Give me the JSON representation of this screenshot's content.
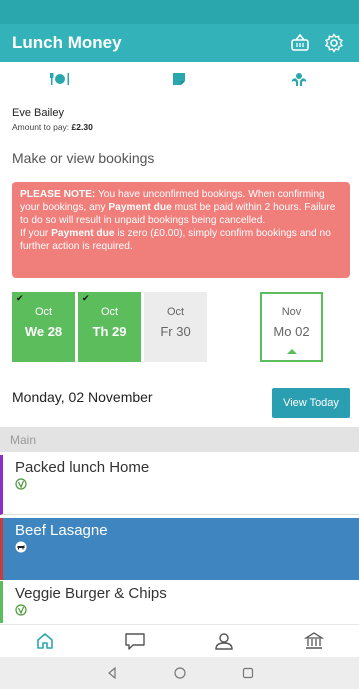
{
  "app": {
    "title": "Lunch Money"
  },
  "colors": {
    "primary": "#33b3b9",
    "confirmed": "#5cbd5c",
    "notice": "#f07f7b",
    "selected_meal": "#3f86c1",
    "button": "#2a9fb2"
  },
  "header_icons": [
    "basket-icon",
    "gear-icon"
  ],
  "tabs": [
    "meal-icon",
    "note-icon",
    "allergy-icon"
  ],
  "student": {
    "name": "Eve Bailey",
    "amount_label": "Amount to pay:",
    "amount": "£2.30"
  },
  "section_title": "Make or view bookings",
  "notice": {
    "label": "PLEASE NOTE:",
    "text1": " You have unconfirmed bookings. When confirming your bookings, any ",
    "bold1": "Payment due",
    "text2": " must be paid within 2 hours. Failure to do so will result in unpaid bookings being cancelled.",
    "text3": "If your ",
    "bold2": "Payment due",
    "text4": " is zero (£0.00), simply confirm bookings and no further action is required."
  },
  "days": [
    {
      "month": "Oct",
      "day": "We 28",
      "status": "confirmed",
      "check": "✔"
    },
    {
      "month": "Oct",
      "day": "Th 29",
      "status": "confirmed",
      "check": "✔"
    },
    {
      "month": "Oct",
      "day": "Fr 30",
      "status": "open"
    },
    {
      "month": "Nov",
      "day": "Mo 02",
      "status": "selected"
    }
  ],
  "selected_date": "Monday, 02 November",
  "view_today_label": "View Today",
  "group": "Main",
  "meals": [
    {
      "name": "Packed lunch Home",
      "badge": "vegetarian-icon"
    },
    {
      "name": "Beef Lasagne",
      "badge": "beef-icon"
    },
    {
      "name": "Veggie Burger & Chips",
      "badge": "vegetarian-icon"
    }
  ],
  "bottom_nav": [
    "home-icon",
    "chat-icon",
    "profile-icon",
    "bank-icon"
  ],
  "system_nav": [
    "back-icon",
    "home-circle-icon",
    "recents-icon"
  ]
}
